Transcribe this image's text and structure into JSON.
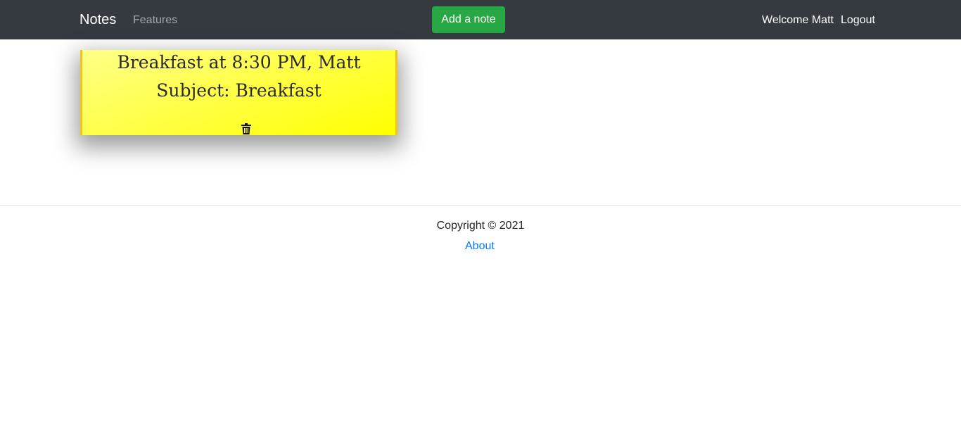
{
  "navbar": {
    "brand": "Notes",
    "features_link": "Features",
    "add_button_label": "Add a note",
    "welcome_text": "Welcome Matt",
    "logout_label": "Logout",
    "background_color": "#343a40",
    "add_button_color": "#28a745"
  },
  "notes": [
    {
      "title": "Breakfast at 8:30 PM, Matt",
      "subject": "Subject: Breakfast",
      "delete_icon": "trash-icon",
      "color": "#ffff00"
    }
  ],
  "footer": {
    "copyright": "Copyright © 2021",
    "about_link": "About",
    "link_color": "#007bff"
  }
}
